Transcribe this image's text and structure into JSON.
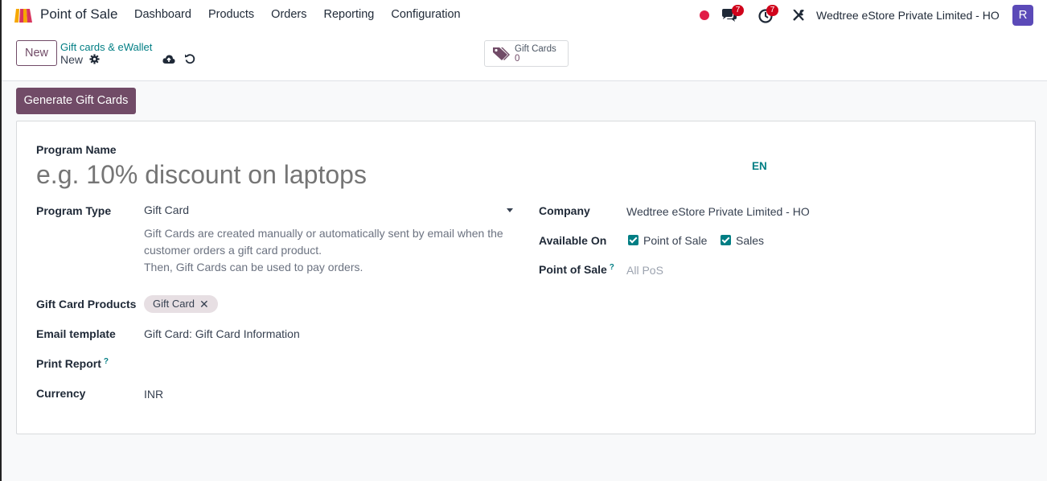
{
  "navbar": {
    "app_name": "Point of Sale",
    "menu": [
      "Dashboard",
      "Products",
      "Orders",
      "Reporting",
      "Configuration"
    ],
    "chat_count": "7",
    "activity_count": "7",
    "company": "Wedtree eStore Private Limited - HO",
    "avatar_letter": "R"
  },
  "control": {
    "new_label": "New",
    "breadcrumb_parent": "Gift cards & eWallet",
    "breadcrumb_current": "New",
    "smart_button": {
      "label": "Gift Cards",
      "count": "0"
    }
  },
  "generate_label": "Generate Gift Cards",
  "form": {
    "program_name_label": "Program Name",
    "program_name_placeholder": "e.g. 10% discount on laptops",
    "lang": "EN",
    "program_type_label": "Program Type",
    "program_type_value": "Gift Card",
    "program_type_desc_1": "Gift Cards are created manually or automatically sent by email when the customer orders a gift card product.",
    "program_type_desc_2": "Then, Gift Cards can be used to pay orders.",
    "gift_card_products_label": "Gift Card Products",
    "gift_card_products_tag": "Gift Card",
    "email_template_label": "Email template",
    "email_template_value": "Gift Card: Gift Card Information",
    "print_report_label": "Print Report",
    "currency_label": "Currency",
    "currency_value": "INR",
    "company_label": "Company",
    "company_value": "Wedtree eStore Private Limited - HO",
    "available_on_label": "Available On",
    "available_on_pos": "Point of Sale",
    "available_on_sales": "Sales",
    "point_of_sale_label": "Point of Sale",
    "point_of_sale_placeholder": "All PoS",
    "help_mark": "?"
  },
  "colors": {
    "brand": "#714b67",
    "accent": "#017e84",
    "badge": "#d0021b"
  }
}
